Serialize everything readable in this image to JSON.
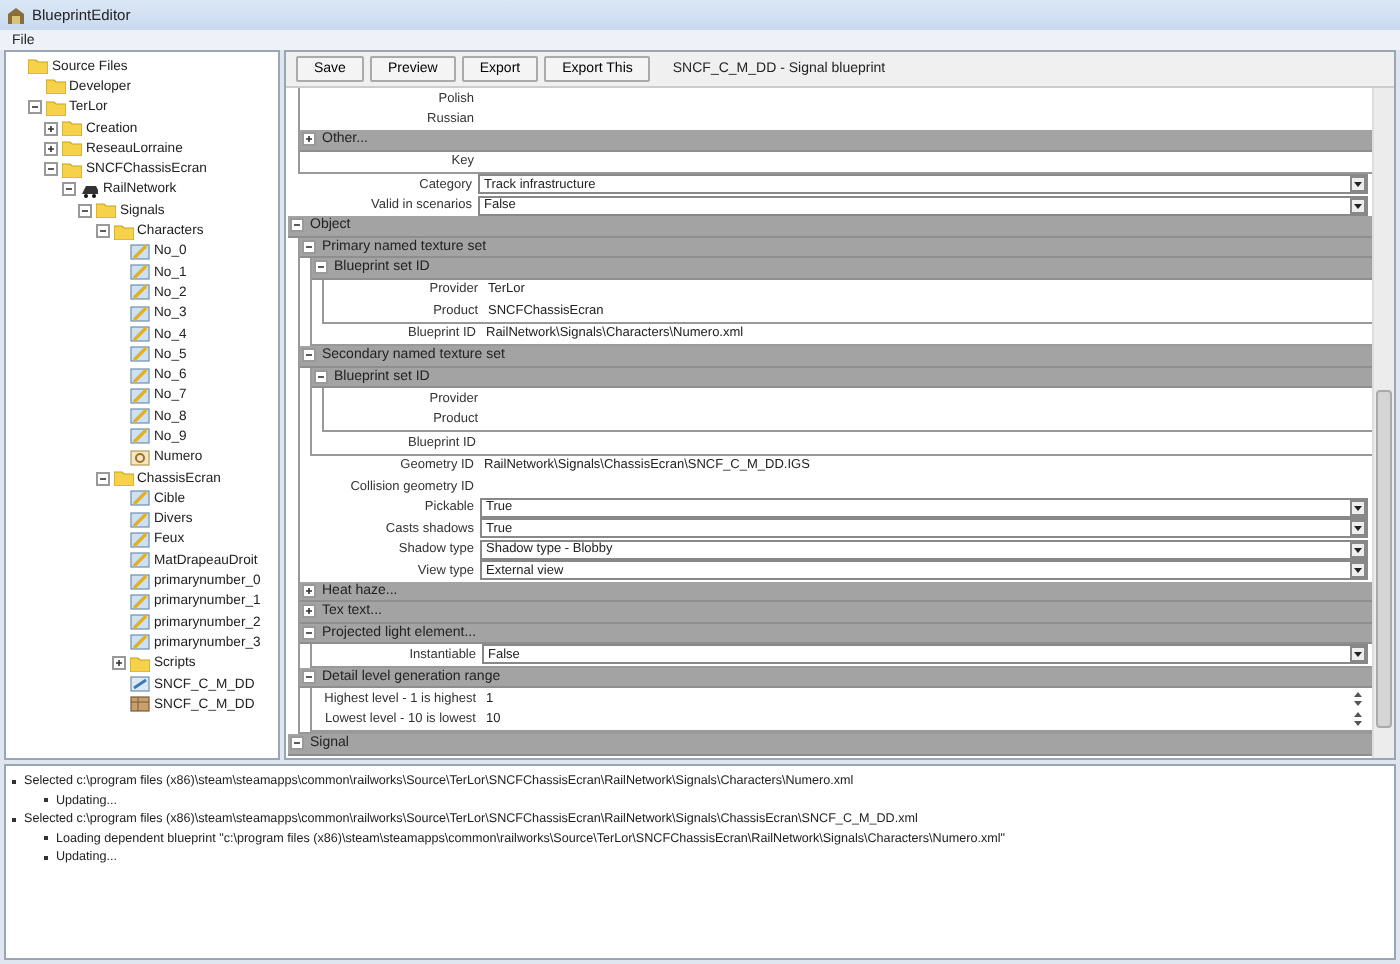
{
  "window": {
    "title": "BlueprintEditor"
  },
  "menu": [
    "File"
  ],
  "tree": [
    {
      "label": "Source Files",
      "kind": "folder",
      "children": [
        {
          "label": "Developer",
          "kind": "folder"
        },
        {
          "label": "TerLor",
          "kind": "folder",
          "expanded": true,
          "children": [
            {
              "label": "Creation",
              "kind": "folder",
              "expanded": false
            },
            {
              "label": "ReseauLorraine",
              "kind": "folder",
              "expanded": false
            },
            {
              "label": "SNCFChassisEcran",
              "kind": "folder",
              "expanded": true,
              "children": [
                {
                  "label": "RailNetwork",
                  "kind": "network",
                  "expanded": true,
                  "children": [
                    {
                      "label": "Signals",
                      "kind": "folder",
                      "expanded": true,
                      "children": [
                        {
                          "label": "Characters",
                          "kind": "folder",
                          "expanded": true,
                          "children": [
                            {
                              "label": "No_0",
                              "kind": "blueprint"
                            },
                            {
                              "label": "No_1",
                              "kind": "blueprint"
                            },
                            {
                              "label": "No_2",
                              "kind": "blueprint"
                            },
                            {
                              "label": "No_3",
                              "kind": "blueprint"
                            },
                            {
                              "label": "No_4",
                              "kind": "blueprint"
                            },
                            {
                              "label": "No_5",
                              "kind": "blueprint"
                            },
                            {
                              "label": "No_6",
                              "kind": "blueprint"
                            },
                            {
                              "label": "No_7",
                              "kind": "blueprint"
                            },
                            {
                              "label": "No_8",
                              "kind": "blueprint"
                            },
                            {
                              "label": "No_9",
                              "kind": "blueprint"
                            },
                            {
                              "label": "Numero",
                              "kind": "special"
                            }
                          ]
                        },
                        {
                          "label": "ChassisEcran",
                          "kind": "folder",
                          "expanded": true,
                          "children": [
                            {
                              "label": "Cible",
                              "kind": "blueprint"
                            },
                            {
                              "label": "Divers",
                              "kind": "blueprint"
                            },
                            {
                              "label": "Feux",
                              "kind": "blueprint"
                            },
                            {
                              "label": "MatDrapeauDroit",
                              "kind": "blueprint"
                            },
                            {
                              "label": "primarynumber_0",
                              "kind": "blueprint"
                            },
                            {
                              "label": "primarynumber_1",
                              "kind": "blueprint"
                            },
                            {
                              "label": "primarynumber_2",
                              "kind": "blueprint"
                            },
                            {
                              "label": "primarynumber_3",
                              "kind": "blueprint"
                            },
                            {
                              "label": "Scripts",
                              "kind": "folder",
                              "expanded": false
                            },
                            {
                              "label": "SNCF_C_M_DD",
                              "kind": "signal"
                            },
                            {
                              "label": "SNCF_C_M_DD",
                              "kind": "mesh"
                            }
                          ]
                        }
                      ]
                    }
                  ]
                }
              ]
            }
          ]
        }
      ]
    }
  ],
  "toolbar": {
    "buttons": [
      "Save",
      "Preview",
      "Export",
      "Export This"
    ],
    "title": "SNCF_C_M_DD - Signal blueprint"
  },
  "properties": [
    {
      "kind": "group",
      "children": [
        {
          "kind": "field",
          "label": "Polish"
        },
        {
          "kind": "field",
          "label": "Russian"
        },
        {
          "kind": "section",
          "label": "Other...",
          "expanded": false
        },
        {
          "kind": "field",
          "label": "Key"
        }
      ]
    },
    {
      "kind": "combo",
      "label": "Category",
      "value": "Track infrastructure"
    },
    {
      "kind": "combo",
      "label": "Valid in scenarios",
      "value": "False"
    },
    {
      "kind": "section",
      "label": "Object",
      "expanded": true,
      "children": [
        {
          "kind": "section",
          "label": "Primary named texture set",
          "expanded": true,
          "children": [
            {
              "kind": "section",
              "label": "Blueprint set ID",
              "expanded": true,
              "children": [
                {
                  "kind": "field",
                  "label": "Provider",
                  "value": "TerLor"
                },
                {
                  "kind": "field",
                  "label": "Product",
                  "value": "SNCFChassisEcran"
                }
              ]
            },
            {
              "kind": "field",
              "label": "Blueprint ID",
              "value": "RailNetwork\\Signals\\Characters\\Numero.xml"
            }
          ]
        },
        {
          "kind": "section",
          "label": "Secondary named texture set",
          "expanded": true,
          "children": [
            {
              "kind": "section",
              "label": "Blueprint set ID",
              "expanded": true,
              "children": [
                {
                  "kind": "field",
                  "label": "Provider"
                },
                {
                  "kind": "field",
                  "label": "Product"
                }
              ]
            },
            {
              "kind": "field",
              "label": "Blueprint ID"
            }
          ]
        },
        {
          "kind": "field",
          "label": "Geometry ID",
          "value": "RailNetwork\\Signals\\ChassisEcran\\SNCF_C_M_DD.IGS"
        },
        {
          "kind": "field",
          "label": "Collision geometry ID"
        },
        {
          "kind": "combo",
          "label": "Pickable",
          "value": "True"
        },
        {
          "kind": "combo",
          "label": "Casts shadows",
          "value": "True"
        },
        {
          "kind": "combo",
          "label": "Shadow type",
          "value": "Shadow type - Blobby"
        },
        {
          "kind": "combo",
          "label": "View type",
          "value": "External view"
        },
        {
          "kind": "section",
          "label": "Heat haze...",
          "expanded": false
        },
        {
          "kind": "section",
          "label": "Tex text...",
          "expanded": false
        },
        {
          "kind": "section",
          "label": "Projected light element...",
          "expanded": true,
          "children": [
            {
              "kind": "combo",
              "label": "Instantiable",
              "value": "False"
            }
          ]
        },
        {
          "kind": "section",
          "label": "Detail level generation range",
          "expanded": true,
          "children": [
            {
              "kind": "spin",
              "label": "Highest level - 1 is highest",
              "value": "1"
            },
            {
              "kind": "spin",
              "label": "Lowest level - 10 is lowest",
              "value": "10"
            }
          ]
        }
      ]
    },
    {
      "kind": "section",
      "label": "Signal",
      "expanded": true
    }
  ],
  "log": [
    {
      "text": "Selected c:\\program files (x86)\\steam\\steamapps\\common\\railworks\\Source\\TerLor\\SNCFChassisEcran\\RailNetwork\\Signals\\Characters\\Numero.xml",
      "children": [
        {
          "text": "Updating..."
        }
      ]
    },
    {
      "text": "Selected c:\\program files (x86)\\steam\\steamapps\\common\\railworks\\Source\\TerLor\\SNCFChassisEcran\\RailNetwork\\Signals\\ChassisEcran\\SNCF_C_M_DD.xml",
      "children": [
        {
          "text": "Loading dependent blueprint \"c:\\program files (x86)\\steam\\steamapps\\common\\railworks\\Source\\TerLor\\SNCFChassisEcran\\RailNetwork\\Signals\\Characters\\Numero.xml\""
        },
        {
          "text": "Updating..."
        }
      ]
    }
  ]
}
